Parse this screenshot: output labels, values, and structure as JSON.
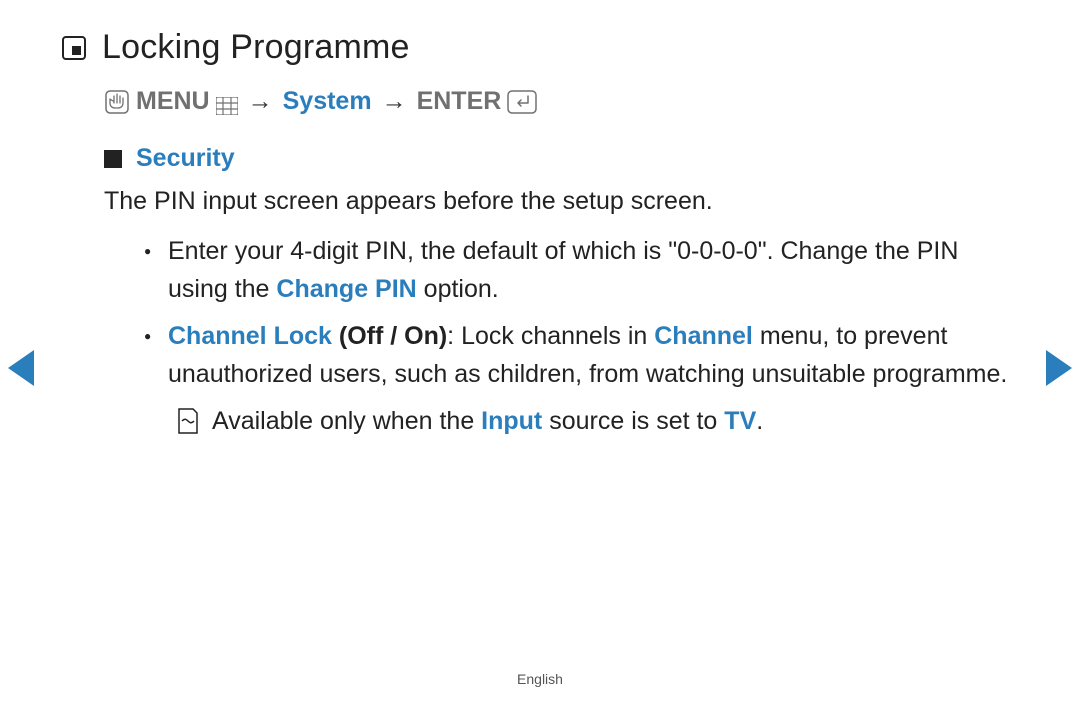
{
  "title": "Locking Programme",
  "breadcrumb": {
    "menu_label": "MENU",
    "system_label": "System",
    "enter_label": "ENTER",
    "arrow": "→"
  },
  "section": {
    "title": "Security",
    "description": "The PIN input screen appears before the setup screen.",
    "bullet1": {
      "pre": "Enter your 4-digit PIN, the default of which is \"0-0-0-0\". Change the PIN using the ",
      "change_pin": "Change PIN",
      "post": " option."
    },
    "bullet2": {
      "channel_lock": "Channel Lock",
      "off_on": " (Off / On)",
      "colon_lock_in": ": Lock channels in ",
      "channel": "Channel",
      "rest": " menu, to prevent unauthorized users, such as children, from watching unsuitable programme."
    },
    "note": {
      "pre": "Available only when the ",
      "input": "Input",
      "mid": " source is set to ",
      "tv": "TV",
      "end": "."
    }
  },
  "footer": {
    "language": "English"
  }
}
